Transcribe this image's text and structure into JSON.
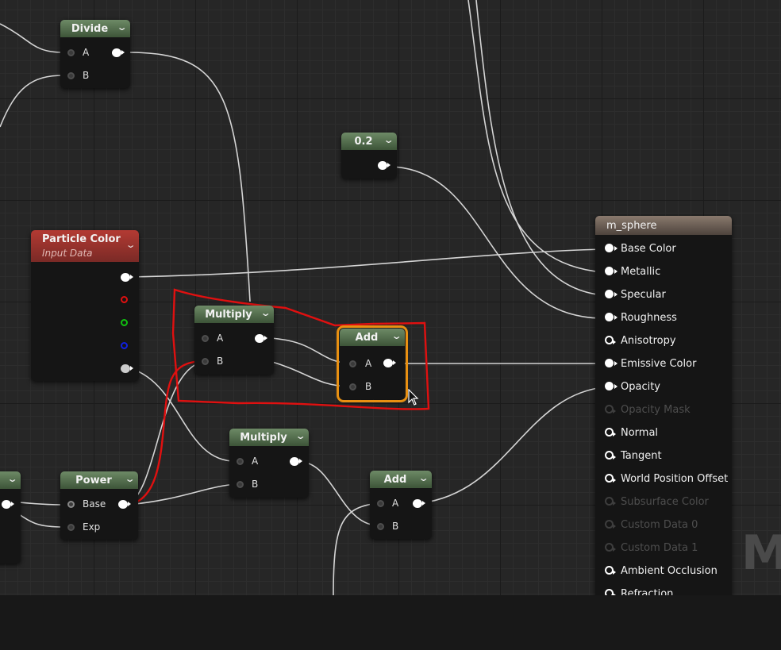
{
  "nodes": {
    "divide": {
      "title": "Divide",
      "a": "A",
      "b": "B"
    },
    "constant": {
      "title": "0.2"
    },
    "particle_color": {
      "title": "Particle Color",
      "subtitle": "Input Data"
    },
    "multiply1": {
      "title": "Multiply",
      "a": "A",
      "b": "B"
    },
    "add1": {
      "title": "Add",
      "a": "A",
      "b": "B"
    },
    "multiply2": {
      "title": "Multiply",
      "a": "A",
      "b": "B"
    },
    "power": {
      "title": "Power",
      "base": "Base",
      "exp": "Exp"
    },
    "add2": {
      "title": "Add",
      "a": "A",
      "b": "B"
    }
  },
  "material": {
    "title": "m_sphere",
    "inputs": [
      {
        "label": "Base Color",
        "state": "connected"
      },
      {
        "label": "Metallic",
        "state": "connected"
      },
      {
        "label": "Specular",
        "state": "connected"
      },
      {
        "label": "Roughness",
        "state": "connected"
      },
      {
        "label": "Anisotropy",
        "state": "empty"
      },
      {
        "label": "Emissive Color",
        "state": "connected"
      },
      {
        "label": "Opacity",
        "state": "connected"
      },
      {
        "label": "Opacity Mask",
        "state": "disabled"
      },
      {
        "label": "Normal",
        "state": "empty"
      },
      {
        "label": "Tangent",
        "state": "empty"
      },
      {
        "label": "World Position Offset",
        "state": "empty"
      },
      {
        "label": "Subsurface Color",
        "state": "disabled"
      },
      {
        "label": "Custom Data 0",
        "state": "disabled"
      },
      {
        "label": "Custom Data 1",
        "state": "disabled"
      },
      {
        "label": "Ambient Occlusion",
        "state": "empty"
      },
      {
        "label": "Refraction",
        "state": "empty"
      }
    ]
  },
  "watermark": "M",
  "colors": {
    "annotation": "#e01010",
    "selection": "#e89012",
    "particle_header": "#b02a25",
    "node_header": "#5a7552"
  },
  "icons": {
    "dropdown": "chevron-down-icon",
    "cursor": "mouse-cursor-icon"
  }
}
